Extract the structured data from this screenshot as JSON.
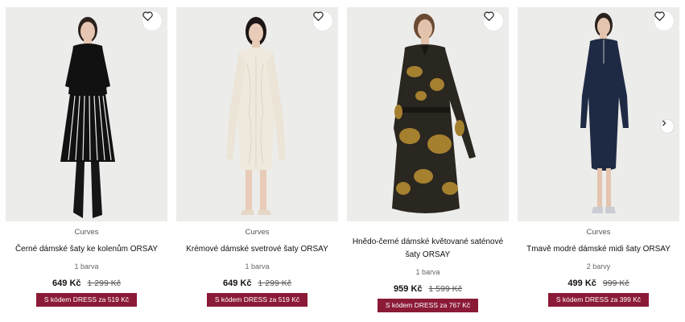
{
  "products": [
    {
      "brand": "Curves",
      "name": "Černé dámské šaty ke kolenům ORSAY",
      "colors": "1 barva",
      "price": "649 Kč",
      "old_price": "1 299 Kč",
      "promo": "S kódem DRESS za 519 Kč",
      "wishlist_icon": "heart-outline-icon"
    },
    {
      "brand": "Curves",
      "name": "Krémové dámské svetrové šaty ORSAY",
      "colors": "1 barva",
      "price": "649 Kč",
      "old_price": "1 299 Kč",
      "promo": "S kódem DRESS za 519 Kč",
      "wishlist_icon": "heart-outline-icon"
    },
    {
      "brand": "",
      "name": "Hnědo-černé dámské květované saténové šaty ORSAY",
      "colors": "1 barva",
      "price": "959 Kč",
      "old_price": "1 599 Kč",
      "promo": "S kódem DRESS za 767 Kč",
      "wishlist_icon": "heart-outline-icon"
    },
    {
      "brand": "Curves",
      "name": "Tmavě modré dámské midi šaty ORSAY",
      "colors": "2 barvy",
      "price": "499 Kč",
      "old_price": "999 Kč",
      "promo": "S kódem DRESS za 399 Kč",
      "wishlist_icon": "heart-outline-icon"
    }
  ],
  "carousel": {
    "next_icon": "chevron-right-icon"
  },
  "theme": {
    "promo_color": "#8b1a37",
    "photo_bg": "#ececea"
  }
}
